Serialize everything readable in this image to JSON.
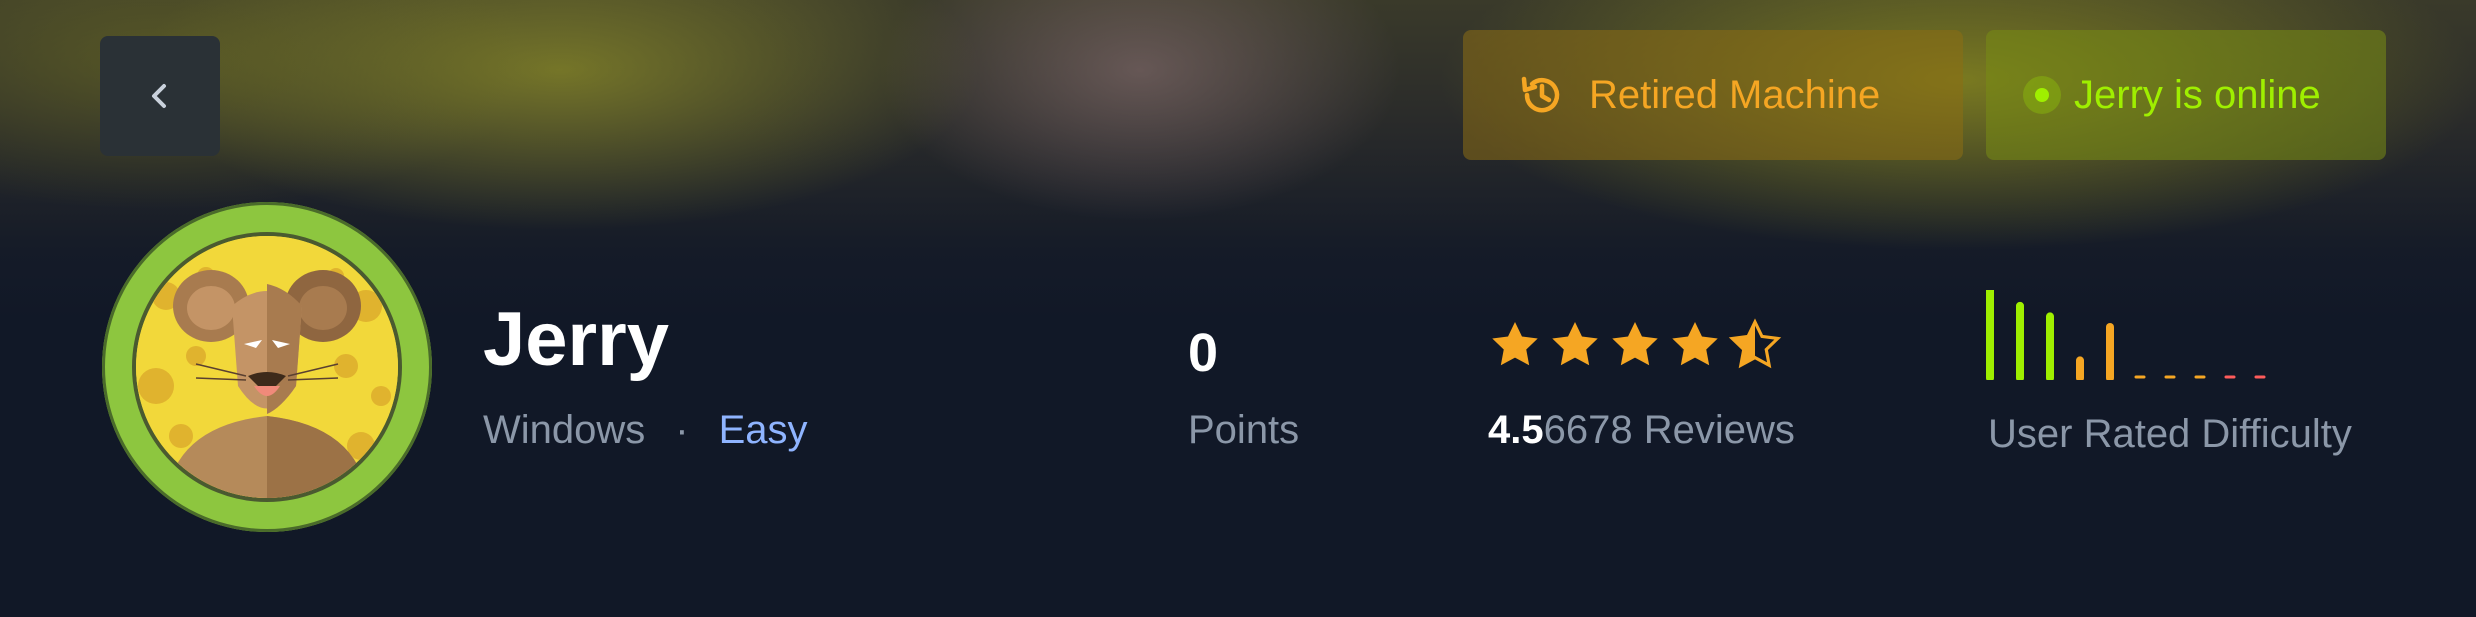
{
  "colors": {
    "accent_green": "#9fef00",
    "accent_orange": "#f5a623",
    "accent_blue": "#8fb4ff",
    "muted_text": "#8b97a8",
    "background": "#111827"
  },
  "header": {
    "back_icon": "chevron-left-icon",
    "retired_label": "Retired Machine",
    "retired_icon": "history-icon",
    "online_label": "Jerry is online",
    "online_icon": "status-dot-icon"
  },
  "machine": {
    "name": "Jerry",
    "os": "Windows",
    "separator": "·",
    "difficulty": "Easy",
    "avatar_icon": "mouse-avatar"
  },
  "stats": {
    "points_value": "0",
    "points_label": "Points",
    "rating_score": "4.5",
    "rating_reviews": "6678 Reviews",
    "stars_filled": 4,
    "stars_half": 1,
    "star_icon": "star-icon",
    "difficulty_label": "User Rated Difficulty",
    "difficulty_bars": [
      {
        "level": 1.0,
        "color": "#9fef00"
      },
      {
        "level": 0.82,
        "color": "#9fef00"
      },
      {
        "level": 0.7,
        "color": "#9fef00"
      },
      {
        "level": 0.2,
        "color": "#f5a623"
      },
      {
        "level": 0.58,
        "color": "#f5a623"
      },
      {
        "level": 0,
        "color": "#f5a623"
      },
      {
        "level": 0,
        "color": "#f5a623"
      },
      {
        "level": 0,
        "color": "#f5a623"
      },
      {
        "level": 0,
        "color": "#ff5b5b"
      },
      {
        "level": 0,
        "color": "#ff5b5b"
      }
    ]
  }
}
